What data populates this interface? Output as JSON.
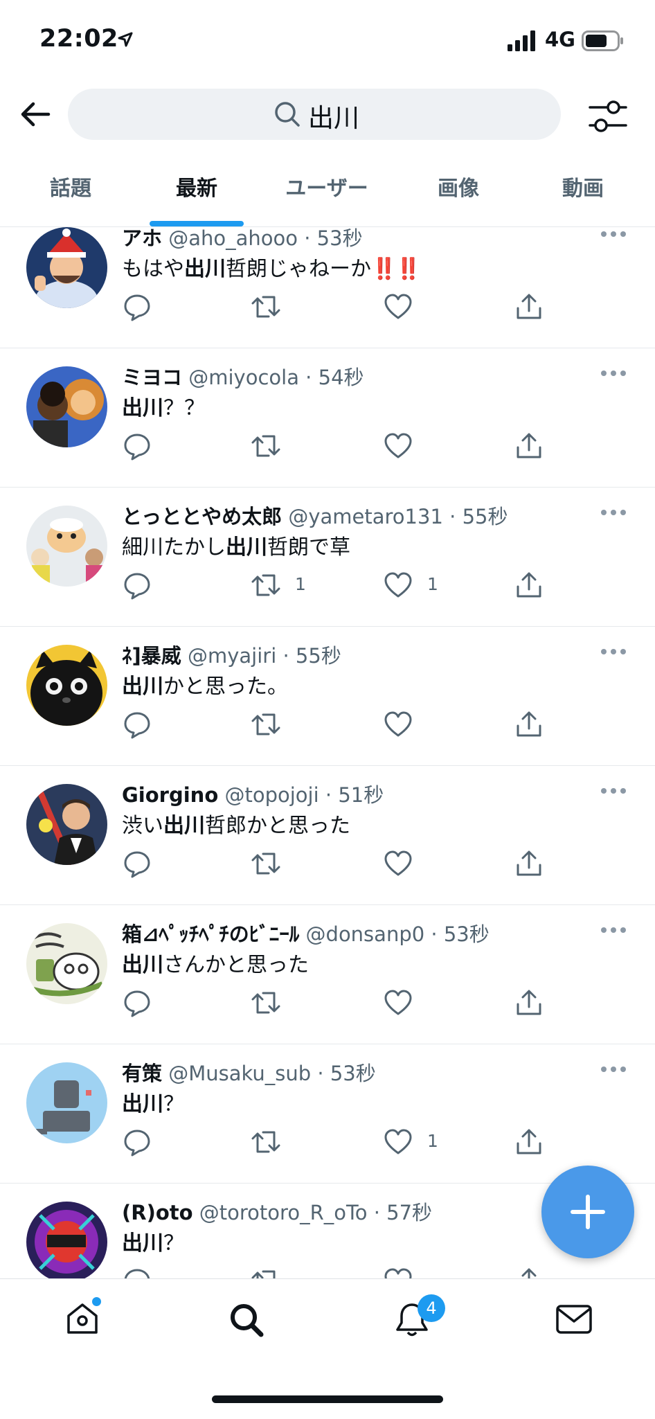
{
  "status_bar": {
    "time": "22:02",
    "network": "4G"
  },
  "search": {
    "query": "出川"
  },
  "tabs": [
    {
      "label": "話題",
      "active": false
    },
    {
      "label": "最新",
      "active": true
    },
    {
      "label": "ユーザー",
      "active": false
    },
    {
      "label": "画像",
      "active": false
    },
    {
      "label": "動画",
      "active": false
    }
  ],
  "tweets": [
    {
      "name": "アホ",
      "handle": "@aho_ahooo",
      "time": "53秒",
      "text_before": "もはや",
      "keyword": "出川",
      "text_after": "哲朗じゃねーか",
      "emoji": "‼️‼️",
      "retweets": "",
      "likes": ""
    },
    {
      "name": "ミヨコ",
      "handle": "@miyocola",
      "time": "54秒",
      "text_before": "",
      "keyword": "出川",
      "text_after": "？？",
      "emoji": "",
      "retweets": "",
      "likes": ""
    },
    {
      "name": "とっととやめ太郎",
      "handle": "@yametaro131",
      "time": "55秒",
      "text_before": "細川たかし",
      "keyword": "出川",
      "text_after": "哲朗で草",
      "emoji": "",
      "retweets": "1",
      "likes": "1"
    },
    {
      "name": "ﾈ]暴威",
      "handle": "@myajiri",
      "time": "55秒",
      "text_before": "",
      "keyword": "出川",
      "text_after": "かと思った。",
      "emoji": "",
      "retweets": "",
      "likes": ""
    },
    {
      "name": "Giorgino",
      "handle": "@topojoji",
      "time": "51秒",
      "text_before": "渋い",
      "keyword": "出川",
      "text_after": "哲郎かと思った",
      "emoji": "",
      "retweets": "",
      "likes": ""
    },
    {
      "name": "箱⊿ﾍﾟｯﾁﾍﾟﾁのﾋﾞﾆｰﾙ",
      "handle": "@donsanp0",
      "time": "53秒",
      "text_before": "",
      "keyword": "出川",
      "text_after": "さんかと思った",
      "emoji": "",
      "retweets": "",
      "likes": ""
    },
    {
      "name": "有策",
      "handle": "@Musaku_sub",
      "time": "53秒",
      "text_before": "",
      "keyword": "出川",
      "text_after": "？",
      "emoji": "",
      "retweets": "",
      "likes": "1"
    },
    {
      "name": "(R)oto",
      "handle": "@torotoro_R_oTo",
      "time": "57秒",
      "text_before": "",
      "keyword": "出川",
      "text_after": "？",
      "emoji": "",
      "retweets": "",
      "likes": ""
    }
  ],
  "bottom_nav": {
    "notifications_badge": "4"
  },
  "icons": [
    "back-arrow-icon",
    "search-icon",
    "filter-icon",
    "more-icon",
    "reply-icon",
    "retweet-icon",
    "like-icon",
    "share-icon",
    "compose-plus-icon",
    "home-icon",
    "explore-search-icon",
    "notifications-bell-icon",
    "messages-envelope-icon"
  ],
  "colors": {
    "accent": "#1d9bf0",
    "fab": "#4a99e9",
    "muted_text": "#536471",
    "alert_red": "#e0243b"
  }
}
